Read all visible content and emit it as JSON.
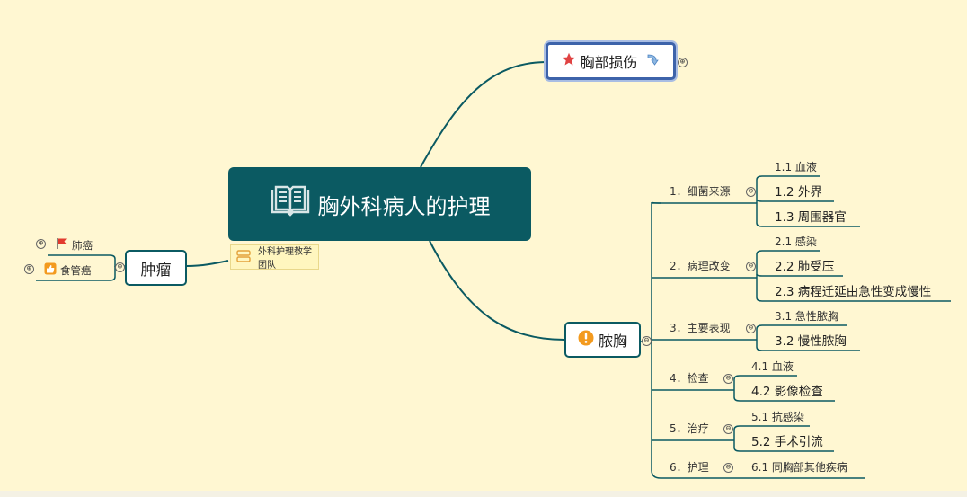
{
  "root": {
    "title": "胸外科病人的护理",
    "icon": "book-icon"
  },
  "label": {
    "text": "外科护理教学团队"
  },
  "branches": {
    "chest_injury": {
      "title": "胸部损伤",
      "icon": "star-icon",
      "extra_icon": "down-arrow-icon",
      "toggle": "⊕"
    },
    "empyema": {
      "title": "脓胸",
      "icon": "exclamation-icon",
      "toggle": "⊖",
      "children": [
        {
          "label": "1．细菌来源",
          "toggle": "⊖",
          "items": [
            "1.1 血液",
            "1.2 外界",
            "1.3 周围器官"
          ]
        },
        {
          "label": "2．病理改变",
          "toggle": "⊖",
          "items": [
            "2.1 感染",
            "2.2 肺受压",
            "2.3 病程迁延由急性变成慢性"
          ]
        },
        {
          "label": "3．主要表现",
          "toggle": "⊖",
          "items": [
            "3.1 急性脓胸",
            "3.2 慢性脓胸"
          ]
        },
        {
          "label": "4．检查",
          "toggle": "⊖",
          "items": [
            "4.1 血液",
            "4.2 影像检查"
          ]
        },
        {
          "label": "5．治疗",
          "toggle": "⊖",
          "items": [
            "5.1 抗感染",
            "5.2 手术引流"
          ]
        },
        {
          "label": "6．护理",
          "toggle": "⊖",
          "items": [
            "6.1 同胸部其他疾病"
          ]
        }
      ]
    },
    "tumor": {
      "title": "肿瘤",
      "toggle": "⊖",
      "children": [
        {
          "label": "肺癌",
          "icon": "red-flag-icon",
          "toggle": "⊕"
        },
        {
          "label": "食管癌",
          "icon": "thumbs-up-icon",
          "toggle": "⊕"
        }
      ]
    }
  },
  "colors": {
    "background": "#fff7d2",
    "line": "#0b5a62",
    "root": "#0b5a62",
    "chest_border": "#3d63aa"
  }
}
